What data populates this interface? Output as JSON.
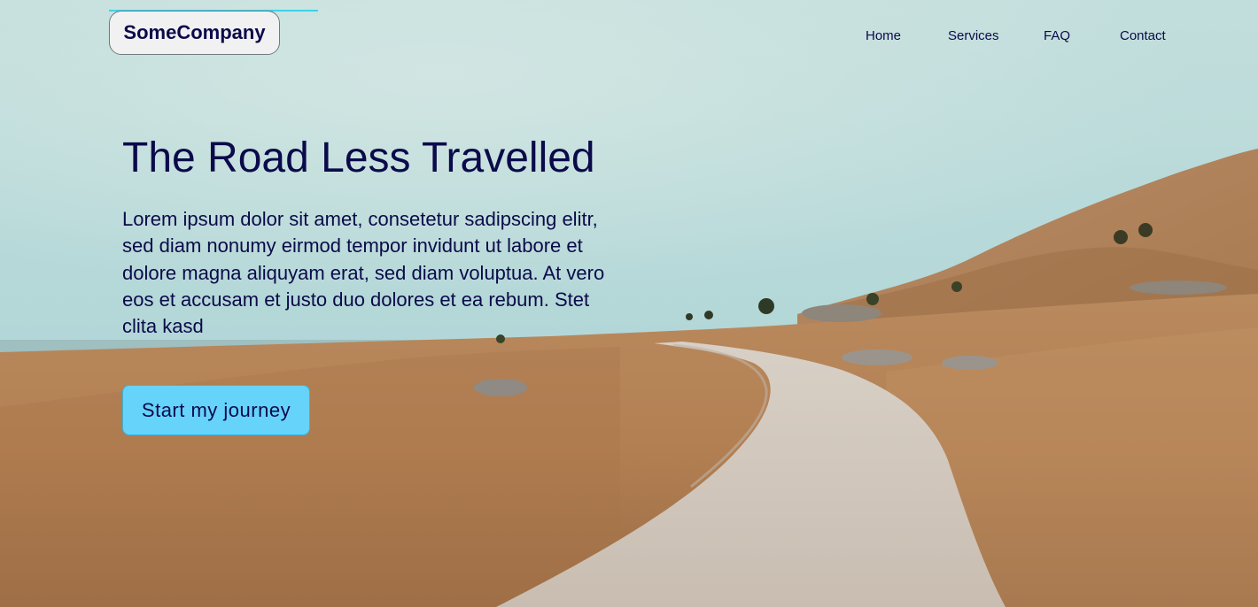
{
  "brand": {
    "name": "SomeCompany"
  },
  "nav": {
    "items": [
      "Home",
      "Services",
      "FAQ",
      "Contact"
    ]
  },
  "hero": {
    "title": "The Road Less Travelled",
    "description": "Lorem ipsum dolor sit amet, consetetur sadipscing elitr, sed diam nonumy eirmod tempor invidunt ut labore et dolore magna aliquyam erat, sed diam voluptua. At vero eos et accusam et justo duo dolores et ea rebum. Stet clita kasd",
    "cta_label": "Start my journey"
  },
  "colors": {
    "text": "#0b0a4a",
    "cta_background": "#66d3fb",
    "logo_background": "#f2f1f1",
    "accent_line": "#3fd0ea"
  }
}
